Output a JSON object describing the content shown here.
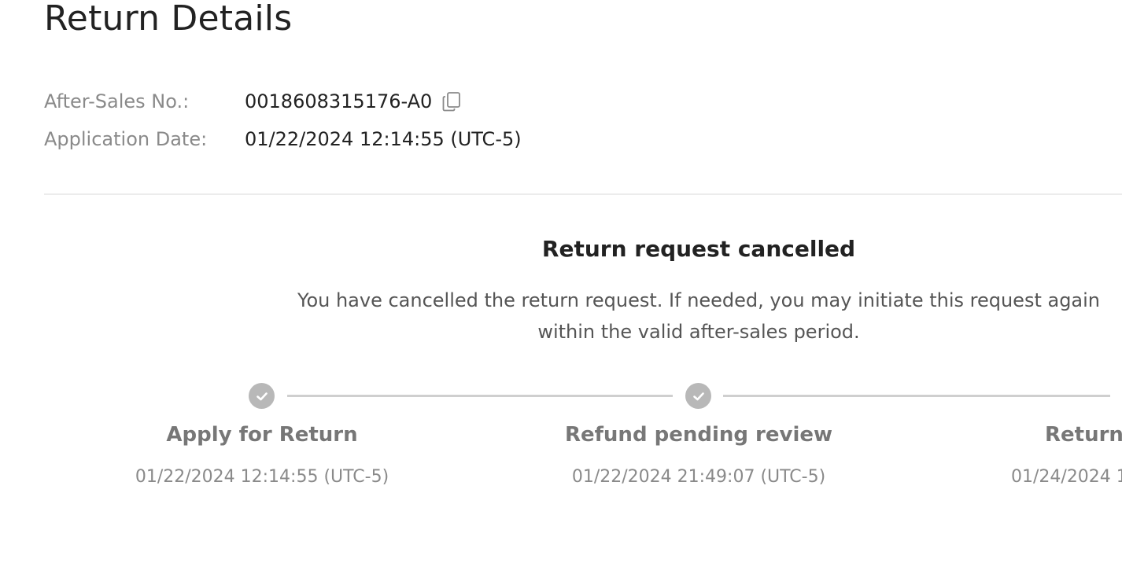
{
  "page": {
    "title": "Return Details"
  },
  "info": {
    "after_sales_label": "After-Sales No.:",
    "after_sales_value": "0018608315176-A0",
    "application_date_label": "Application Date:",
    "application_date_value": "01/22/2024 12:14:55 (UTC-5)"
  },
  "status": {
    "title": "Return request cancelled",
    "description": "You have cancelled the return request. If needed, you may initiate this request again within the valid after-sales period."
  },
  "steps": [
    {
      "label": "Apply for Return",
      "date": "01/22/2024 12:14:55 (UTC-5)",
      "icon": "check-circle-icon",
      "completed": true
    },
    {
      "label": "Refund pending review",
      "date": "01/22/2024 21:49:07 (UTC-5)",
      "icon": "check-circle-icon",
      "completed": true
    },
    {
      "label": "Return",
      "date": "01/24/2024 1",
      "completed": false
    }
  ],
  "colors": {
    "step_icon": "#b8b8b8",
    "step_line": "#cfcfcf",
    "label_gray": "#8a8a8a",
    "divider": "#ececec"
  },
  "icons": {
    "copy": "copy-icon"
  }
}
